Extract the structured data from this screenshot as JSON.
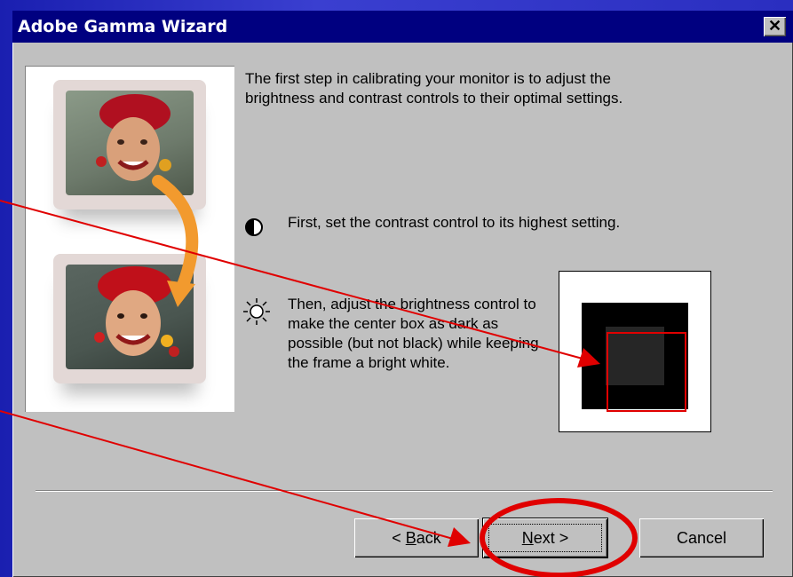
{
  "window": {
    "title": "Adobe Gamma Wizard",
    "close_label": "✕"
  },
  "content": {
    "intro": "The first step in calibrating your monitor is to adjust the brightness and contrast controls to their optimal settings.",
    "step1": "First, set the contrast control to its highest setting.",
    "step2": "Then, adjust the brightness control to make the center box as dark as possible (but not black) while keeping the frame a bright white."
  },
  "buttons": {
    "back_prefix": "< ",
    "back_accel": "B",
    "back_rest": "ack",
    "next_accel": "N",
    "next_rest": "ext >",
    "cancel": "Cancel"
  },
  "icons": {
    "contrast": "contrast-icon",
    "brightness": "sun-icon",
    "close": "close-icon"
  },
  "colors": {
    "titlebar": "#000080",
    "dialog_bg": "#c0c0c0",
    "annotation": "#e00000",
    "test_center": "#262626"
  }
}
